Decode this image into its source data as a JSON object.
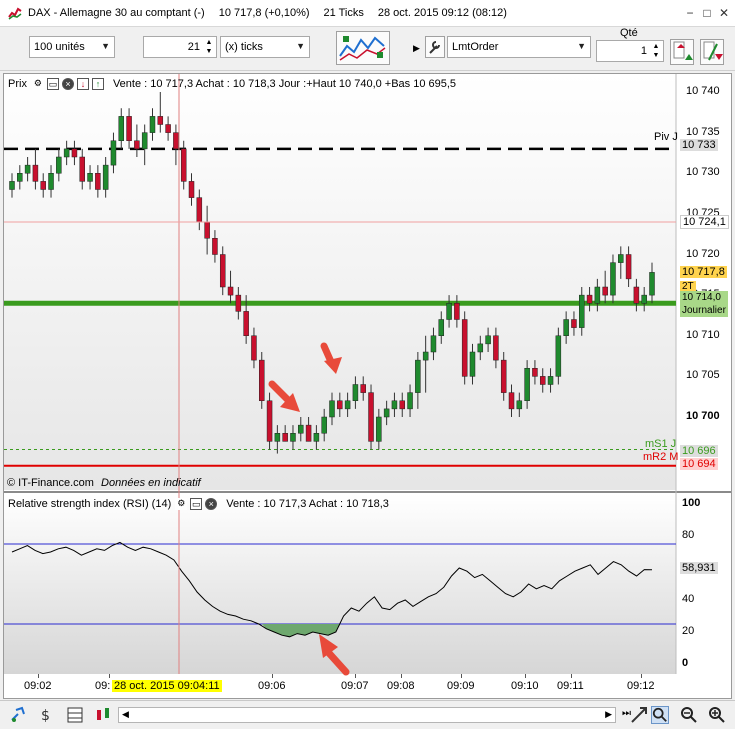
{
  "titlebar": {
    "instrument": "DAX - Allemagne 30 au comptant (-)",
    "price": "10 717,8 (+0,10%)",
    "ticks": "21 Ticks",
    "datetime": "28 oct. 2015 09:12 (08:12)",
    "btn_minimize": "−",
    "btn_maximize": "□",
    "btn_close": "✕"
  },
  "toolbar": {
    "units_value": "100 unités",
    "ticks_count": "21",
    "ticks_unit": "(x) ticks",
    "order_type": "LmtOrder",
    "qty_label": "Qté",
    "qty_value": "1"
  },
  "price_panel": {
    "label": "Prix",
    "info": "Vente : 10 717,3 Achat : 10 718,3 Jour :+Haut 10 740,0 +Bas 10 695,5",
    "copyright": "© IT-Finance.com",
    "disclaimer": "Données en indicatif",
    "piv_label": "Piv J",
    "ms1_label": "mS1 J",
    "mr2_label": "mR2 M",
    "tick_labels": [
      "10 740",
      "10 735",
      "10 730",
      "10 725",
      "10 720",
      "10 715",
      "10 710",
      "10 705",
      "10 700"
    ],
    "box_piv": "10 733",
    "box_last": "10 724,1",
    "box_price": "10 717,8",
    "box_2t": "2T",
    "box_daily_value": "10 714,0",
    "box_daily_label": "Journalier",
    "box_ms1": "10 696",
    "box_mr2": "10 694",
    "colors": {
      "up": "#1f8a2e",
      "down": "#c8102e",
      "pivot_green": "#3a9b1e",
      "mr2_red": "#e00000"
    }
  },
  "rsi_panel": {
    "label": "Relative strength index (RSI) (14)",
    "info": "Vente : 10 717,3 Achat : 10 718,3",
    "tick_labels": [
      "100",
      "80",
      "60",
      "40",
      "20",
      "0"
    ],
    "box_value": "58,931",
    "levels": [
      75,
      25
    ]
  },
  "time_axis": {
    "labels": [
      "09:02",
      "09:",
      "09:06",
      "09:07",
      "09:08",
      "09:09",
      "09:10",
      "09:11",
      "09:12"
    ],
    "cursor_label": "28 oct. 2015 09:04:11"
  },
  "chart_data": {
    "type": "candlestick",
    "instrument": "DAX",
    "ylim": [
      10692,
      10742
    ],
    "candles": [
      [
        10728,
        10730,
        10727,
        10729
      ],
      [
        10729,
        10731,
        10728,
        10730
      ],
      [
        10730,
        10732,
        10729,
        10731
      ],
      [
        10731,
        10733,
        10728,
        10729
      ],
      [
        10729,
        10730,
        10727,
        10728
      ],
      [
        10728,
        10731,
        10727,
        10730
      ],
      [
        10730,
        10733,
        10729,
        10732
      ],
      [
        10732,
        10734,
        10731,
        10733
      ],
      [
        10733,
        10734,
        10731,
        10732
      ],
      [
        10732,
        10733,
        10728,
        10729
      ],
      [
        10729,
        10731,
        10728,
        10730
      ],
      [
        10730,
        10731,
        10727,
        10728
      ],
      [
        10728,
        10732,
        10727,
        10731
      ],
      [
        10731,
        10735,
        10730,
        10734
      ],
      [
        10734,
        10738,
        10733,
        10737
      ],
      [
        10737,
        10738,
        10733,
        10734
      ],
      [
        10734,
        10736,
        10732,
        10733
      ],
      [
        10733,
        10736,
        10731,
        10735
      ],
      [
        10735,
        10738,
        10734,
        10737
      ],
      [
        10737,
        10740,
        10735,
        10736
      ],
      [
        10736,
        10737,
        10734,
        10735
      ],
      [
        10735,
        10736,
        10731,
        10733
      ],
      [
        10733,
        10734,
        10728,
        10729
      ],
      [
        10729,
        10730,
        10726,
        10727
      ],
      [
        10727,
        10728,
        10723,
        10724
      ],
      [
        10724,
        10726,
        10720,
        10722
      ],
      [
        10722,
        10723,
        10719,
        10720
      ],
      [
        10720,
        10721,
        10715,
        10716
      ],
      [
        10716,
        10718,
        10714,
        10715
      ],
      [
        10715,
        10716,
        10712,
        10713
      ],
      [
        10713,
        10715,
        10709,
        10710
      ],
      [
        10710,
        10711,
        10706,
        10707
      ],
      [
        10707,
        10708,
        10701,
        10702
      ],
      [
        10702,
        10703,
        10696,
        10697
      ],
      [
        10697,
        10699,
        10695.5,
        10698
      ],
      [
        10698,
        10699,
        10697,
        10697
      ],
      [
        10697,
        10699,
        10696,
        10698
      ],
      [
        10698,
        10700,
        10697,
        10699
      ],
      [
        10699,
        10700,
        10697,
        10697
      ],
      [
        10697,
        10699,
        10696,
        10698
      ],
      [
        10698,
        10701,
        10697,
        10700
      ],
      [
        10700,
        10703,
        10699,
        10702
      ],
      [
        10702,
        10703,
        10700,
        10701
      ],
      [
        10701,
        10703,
        10700,
        10702
      ],
      [
        10702,
        10705,
        10701,
        10704
      ],
      [
        10704,
        10705,
        10702,
        10703
      ],
      [
        10703,
        10704,
        10696,
        10697
      ],
      [
        10697,
        10701,
        10696,
        10700
      ],
      [
        10700,
        10702,
        10699,
        10701
      ],
      [
        10701,
        10703,
        10700,
        10702
      ],
      [
        10702,
        10703,
        10700,
        10701
      ],
      [
        10701,
        10704,
        10700,
        10703
      ],
      [
        10703,
        10708,
        10701,
        10707
      ],
      [
        10707,
        10710,
        10703,
        10708
      ],
      [
        10708,
        10711,
        10707,
        10710
      ],
      [
        10710,
        10713,
        10709,
        10712
      ],
      [
        10712,
        10715,
        10711,
        10714
      ],
      [
        10714,
        10715,
        10711,
        10712
      ],
      [
        10712,
        10713,
        10704,
        10705
      ],
      [
        10705,
        10709,
        10704,
        10708
      ],
      [
        10708,
        10710,
        10707,
        10709
      ],
      [
        10709,
        10711,
        10708,
        10710
      ],
      [
        10710,
        10711,
        10706,
        10707
      ],
      [
        10707,
        10708,
        10702,
        10703
      ],
      [
        10703,
        10704,
        10700,
        10701
      ],
      [
        10701,
        10703,
        10700,
        10702
      ],
      [
        10702,
        10707,
        10701,
        10706
      ],
      [
        10706,
        10707,
        10704,
        10705
      ],
      [
        10705,
        10706,
        10703,
        10704
      ],
      [
        10704,
        10706,
        10703,
        10705
      ],
      [
        10705,
        10711,
        10704,
        10710
      ],
      [
        10710,
        10713,
        10709,
        10712
      ],
      [
        10712,
        10713,
        10710,
        10711
      ],
      [
        10711,
        10716,
        10710,
        10715
      ],
      [
        10715,
        10716,
        10713,
        10714
      ],
      [
        10714,
        10717,
        10713,
        10716
      ],
      [
        10716,
        10718,
        10714,
        10715
      ],
      [
        10715,
        10720,
        10714,
        10719
      ],
      [
        10719,
        10721,
        10717,
        10720
      ],
      [
        10720,
        10721,
        10716,
        10717
      ],
      [
        10716,
        10717,
        10713,
        10714
      ],
      [
        10714,
        10716,
        10713,
        10715
      ],
      [
        10715,
        10719,
        10714,
        10717.8
      ]
    ]
  },
  "rsi_data": {
    "values": [
      70,
      72,
      74,
      71,
      69,
      70,
      72,
      73,
      71,
      68,
      70,
      72,
      71,
      74,
      76,
      73,
      71,
      73,
      72,
      70,
      68,
      65,
      58,
      52,
      45,
      40,
      36,
      33,
      31,
      30,
      28,
      27,
      25,
      22,
      20,
      18,
      17,
      19,
      18,
      20,
      19,
      18,
      20,
      30,
      35,
      33,
      38,
      42,
      35,
      34,
      38,
      40,
      36,
      39,
      42,
      44,
      48,
      55,
      60,
      58,
      54,
      56,
      52,
      48,
      44,
      42,
      45,
      50,
      47,
      49,
      47,
      52,
      55,
      58,
      60,
      62,
      56,
      60,
      64,
      62,
      58,
      55,
      59,
      58.9
    ]
  }
}
